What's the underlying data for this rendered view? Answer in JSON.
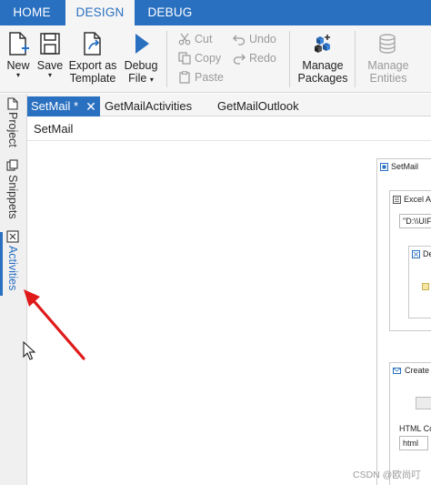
{
  "menu": {
    "tabs": [
      {
        "label": "HOME"
      },
      {
        "label": "DESIGN"
      },
      {
        "label": "DEBUG"
      }
    ],
    "active": "DESIGN"
  },
  "ribbon": {
    "new": {
      "label": "New",
      "dropdown": true
    },
    "save": {
      "label": "Save",
      "dropdown": true
    },
    "export_template": {
      "line1": "Export as",
      "line2": "Template"
    },
    "debug_file": {
      "line1": "Debug",
      "line2": "File"
    },
    "cut": "Cut",
    "copy": "Copy",
    "paste": "Paste",
    "undo": "Undo",
    "redo": "Redo",
    "manage_packages": {
      "line1": "Manage",
      "line2": "Packages"
    },
    "manage_entities": {
      "line1": "Manage",
      "line2": "Entities"
    }
  },
  "side_panel": {
    "tabs": [
      {
        "label": "Project",
        "icon": "file-icon"
      },
      {
        "label": "Snippets",
        "icon": "snippets-icon"
      },
      {
        "label": "Activities",
        "icon": "activities-icon",
        "active": true
      }
    ]
  },
  "document_tabs": [
    {
      "label": "SetMail *",
      "active": true
    },
    {
      "label": "GetMailActivities"
    },
    {
      "label": "GetMailOutlook"
    }
  ],
  "breadcrumb": "SetMail",
  "designer": {
    "sequence_title": "SetMail",
    "excel_activity": "Excel A",
    "excel_path_value": "\"D:\\\\UIF",
    "inner_activity": "De",
    "create_activity": "Create",
    "html_content_label": "HTML Co",
    "html_field_value": "html"
  },
  "watermark": "CSDN @欧尚叮",
  "colors": {
    "accent": "#2a70c0",
    "ribbon_bg": "#f5f5f5",
    "annotation_arrow": "#e01a1a"
  }
}
